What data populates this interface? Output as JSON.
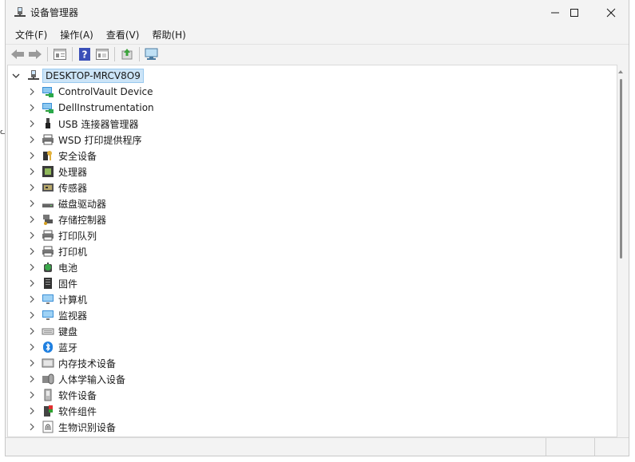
{
  "window": {
    "title": "设备管理器",
    "controls": [
      "minimize",
      "maximize",
      "close"
    ]
  },
  "menu": [
    {
      "label": "文件(F)"
    },
    {
      "label": "操作(A)"
    },
    {
      "label": "查看(V)"
    },
    {
      "label": "帮助(H)"
    }
  ],
  "toolbar": {
    "buttons": [
      "back-arrow-icon",
      "forward-arrow-icon",
      "properties-icon",
      "help-icon",
      "show-hidden-icon",
      "update-driver-icon",
      "scan-hardware-icon"
    ]
  },
  "tree": {
    "root": {
      "label": "DESKTOP-MRCV8O9",
      "expanded": true
    },
    "items": [
      {
        "label": "ControlVault Device",
        "icon": "network-device-icon"
      },
      {
        "label": "DellInstrumentation",
        "icon": "network-device-icon"
      },
      {
        "label": "USB 连接器管理器",
        "icon": "usb-icon"
      },
      {
        "label": "WSD 打印提供程序",
        "icon": "printer-icon"
      },
      {
        "label": "安全设备",
        "icon": "key-icon"
      },
      {
        "label": "处理器",
        "icon": "cpu-icon"
      },
      {
        "label": "传感器",
        "icon": "sensor-icon"
      },
      {
        "label": "磁盘驱动器",
        "icon": "disk-drive-icon"
      },
      {
        "label": "存储控制器",
        "icon": "storage-controller-icon"
      },
      {
        "label": "打印队列",
        "icon": "printer-icon"
      },
      {
        "label": "打印机",
        "icon": "printer-icon"
      },
      {
        "label": "电池",
        "icon": "battery-icon"
      },
      {
        "label": "固件",
        "icon": "firmware-icon"
      },
      {
        "label": "计算机",
        "icon": "monitor-icon"
      },
      {
        "label": "监视器",
        "icon": "monitor-icon"
      },
      {
        "label": "键盘",
        "icon": "keyboard-icon"
      },
      {
        "label": "蓝牙",
        "icon": "bluetooth-icon"
      },
      {
        "label": "内存技术设备",
        "icon": "memory-card-icon"
      },
      {
        "label": "人体学输入设备",
        "icon": "hid-icon"
      },
      {
        "label": "软件设备",
        "icon": "software-device-icon"
      },
      {
        "label": "软件组件",
        "icon": "software-component-icon"
      },
      {
        "label": "生物识别设备",
        "icon": "fingerprint-icon"
      }
    ]
  },
  "colors": {
    "selection_bg": "#cce4f7",
    "selection_border": "#99c9ef",
    "window_bg": "#f3f3f3",
    "bluetooth": "#1e7fe0"
  }
}
